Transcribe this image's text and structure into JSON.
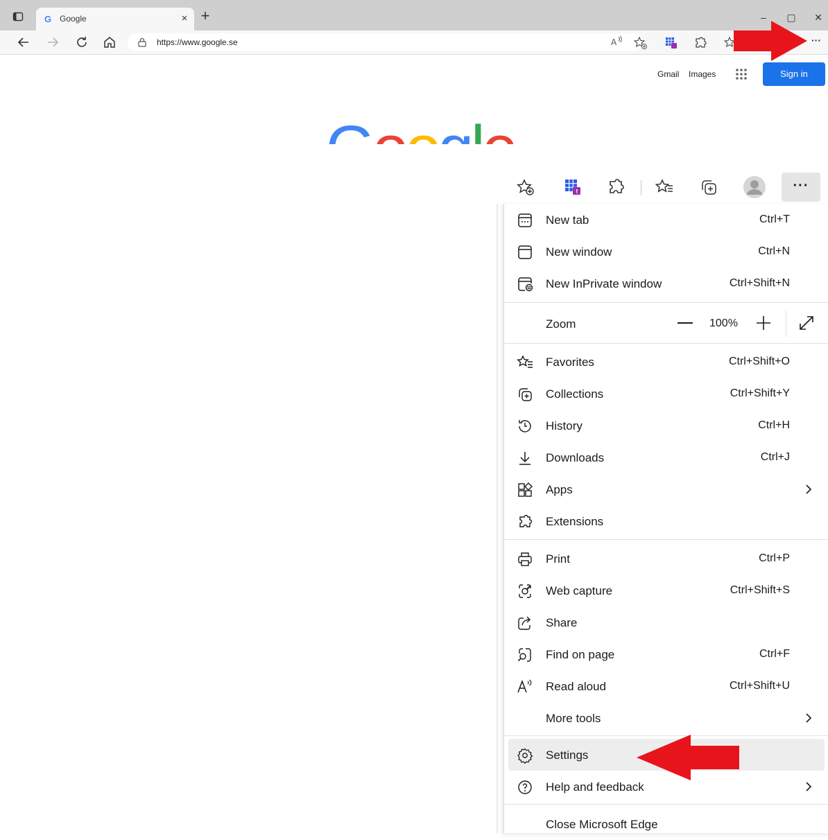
{
  "browser": {
    "tab_title": "Google",
    "tab_favicon": "G",
    "tab_close": "×",
    "new_tab": "+",
    "url": "https://www.google.se",
    "minimize": "–",
    "maximize": "▢",
    "close": "✕",
    "more_label": "···"
  },
  "google": {
    "gmail": "Gmail",
    "images": "Images",
    "sign_in": "Sign in",
    "logo": [
      "G",
      "o",
      "o",
      "g",
      "l",
      "e"
    ],
    "logo_colors": [
      "#4285f4",
      "#ea4335",
      "#fbbc05",
      "#4285f4",
      "#34a853",
      "#ea4335"
    ]
  },
  "menu_toolbar": {
    "icons": [
      "favorites-add-icon",
      "office-apps-icon",
      "extensions-icon",
      "favorites-icon",
      "collections-icon",
      "profile-avatar",
      "more-icon"
    ],
    "more_label": "···"
  },
  "menu": {
    "new_tab": {
      "label": "New tab",
      "shortcut": "Ctrl+T"
    },
    "new_window": {
      "label": "New window",
      "shortcut": "Ctrl+N"
    },
    "inprivate": {
      "label": "New InPrivate window",
      "shortcut": "Ctrl+Shift+N"
    },
    "zoom": {
      "label": "Zoom",
      "value": "100%"
    },
    "favorites": {
      "label": "Favorites",
      "shortcut": "Ctrl+Shift+O"
    },
    "collections": {
      "label": "Collections",
      "shortcut": "Ctrl+Shift+Y"
    },
    "history": {
      "label": "History",
      "shortcut": "Ctrl+H"
    },
    "downloads": {
      "label": "Downloads",
      "shortcut": "Ctrl+J"
    },
    "apps": {
      "label": "Apps"
    },
    "extensions": {
      "label": "Extensions"
    },
    "print": {
      "label": "Print",
      "shortcut": "Ctrl+P"
    },
    "web_capture": {
      "label": "Web capture",
      "shortcut": "Ctrl+Shift+S"
    },
    "share": {
      "label": "Share"
    },
    "find": {
      "label": "Find on page",
      "shortcut": "Ctrl+F"
    },
    "read_aloud": {
      "label": "Read aloud",
      "shortcut": "Ctrl+Shift+U"
    },
    "more_tools": {
      "label": "More tools"
    },
    "settings": {
      "label": "Settings"
    },
    "help": {
      "label": "Help and feedback"
    },
    "close_edge": {
      "label": "Close Microsoft Edge"
    }
  },
  "colors": {
    "annotation_arrow": "#e8141c",
    "signin_blue": "#1a73e8"
  }
}
